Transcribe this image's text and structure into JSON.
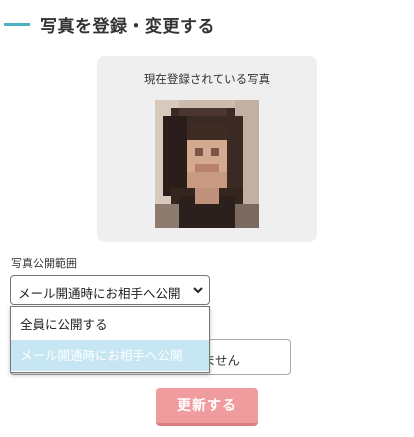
{
  "page": {
    "heading": "写真を登録・変更する"
  },
  "photo_card": {
    "caption": "現在登録されている写真",
    "photo_alt_icon": "blurred-profile-photo"
  },
  "visibility": {
    "label": "写真公開範囲",
    "selected_value": "メール開通時にお相手へ公開",
    "options": [
      "全員に公開する",
      "メール開通時にお相手へ公開"
    ],
    "highlighted_option_index": 1,
    "partially_hidden_field_text": "ません"
  },
  "actions": {
    "update_label": "更新する"
  },
  "colors": {
    "accent_bar": "#4db1c2",
    "button": "#f09b9e",
    "highlight": "#c5e6f2"
  }
}
